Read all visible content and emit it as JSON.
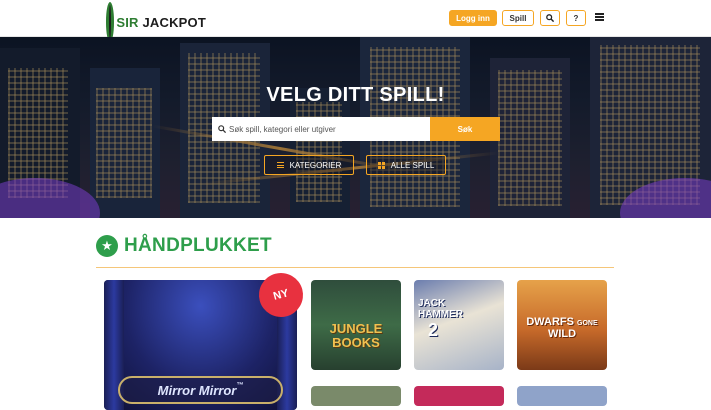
{
  "header": {
    "logo_text_a": "SIR",
    "logo_text_b": "JACKPOT",
    "login_label": "Logg inn",
    "games_label": "Spill",
    "search_icon": "search-icon",
    "help_label": "?",
    "menu_icon": "menu-icon"
  },
  "hero": {
    "title": "VELG DITT SPILL!",
    "search_placeholder": "Søk spill, kategori eller utgiver",
    "search_button": "Søk",
    "categories_button": "KATEGORIER",
    "all_games_button": "ALLE SPILL"
  },
  "section": {
    "title": "HÅNDPLUKKET",
    "icon": "star-icon"
  },
  "games": {
    "featured_badge": "NY",
    "featured_title": "Mirror Mirror",
    "featured_tm": "™",
    "jungle_title_line1": "JUNGLE",
    "jungle_title_line2": "BOOKS",
    "jack_title_line1": "JACK",
    "jack_title_line2": "HAMMER",
    "jack_number": "2",
    "dwarfs_title_a": "DWARFS",
    "dwarfs_title_b": "GONE",
    "dwarfs_title_c": "WILD"
  },
  "colors": {
    "accent": "#f5a623",
    "brand_green": "#2e9e4b",
    "badge_red": "#e8313f"
  }
}
